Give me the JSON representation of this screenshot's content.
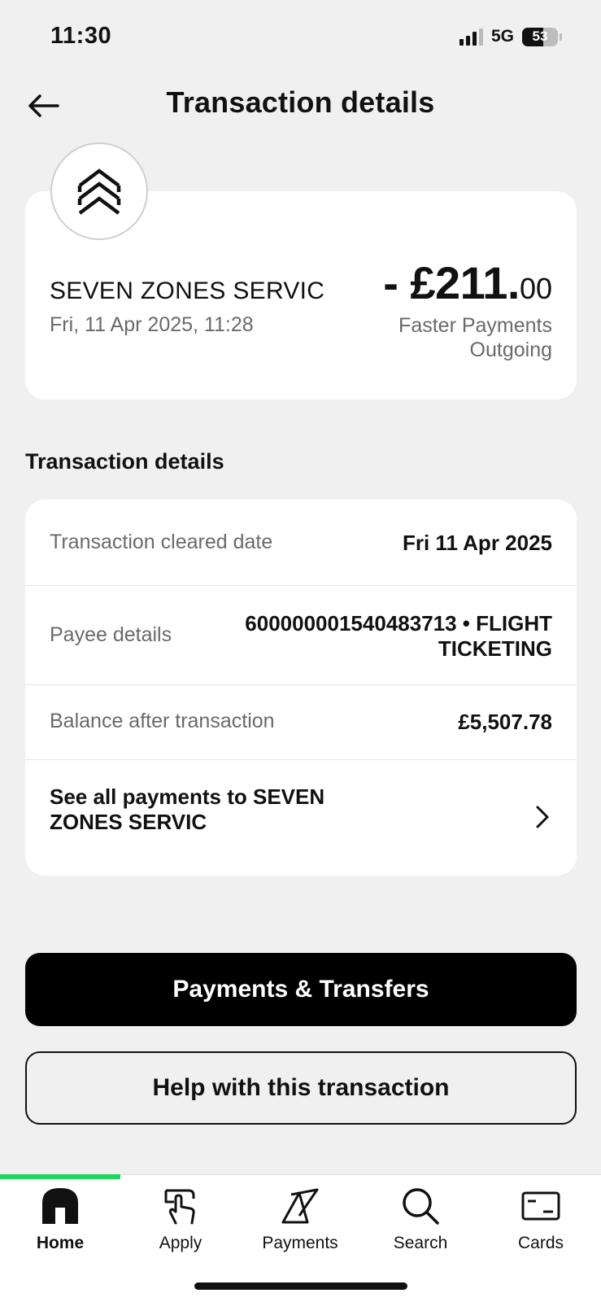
{
  "status_bar": {
    "time": "11:30",
    "network": "5G",
    "battery": "53"
  },
  "header": {
    "title": "Transaction details",
    "back_icon": "arrow-left-icon"
  },
  "summary": {
    "logo_icon": "double-chevron-up-icon",
    "merchant": "SEVEN ZONES SERVIC",
    "datetime": "Fri, 11 Apr 2025, 11:28",
    "amount_main": "- £211.",
    "amount_pence": "00",
    "payment_type": "Faster Payments Outgoing"
  },
  "details": {
    "heading": "Transaction details",
    "cleared_label": "Transaction cleared date",
    "cleared_value": "Fri 11 Apr 2025",
    "payee_label": "Payee details",
    "payee_value": "600000001540483713 • FLIGHT TICKETING",
    "balance_label": "Balance after transaction",
    "balance_value": "£5,507.78",
    "see_all": "See all payments to SEVEN ZONES SERVIC"
  },
  "buttons": {
    "primary": "Payments & Transfers",
    "secondary": "Help with this transaction"
  },
  "tab_bar": {
    "accent_color": "#1ed760",
    "tabs": [
      {
        "label": "Home",
        "icon": "home-icon",
        "active": true
      },
      {
        "label": "Apply",
        "icon": "apply-hand-icon",
        "active": false
      },
      {
        "label": "Payments",
        "icon": "payments-icon",
        "active": false
      },
      {
        "label": "Search",
        "icon": "search-icon",
        "active": false
      },
      {
        "label": "Cards",
        "icon": "card-icon",
        "active": false
      }
    ]
  }
}
